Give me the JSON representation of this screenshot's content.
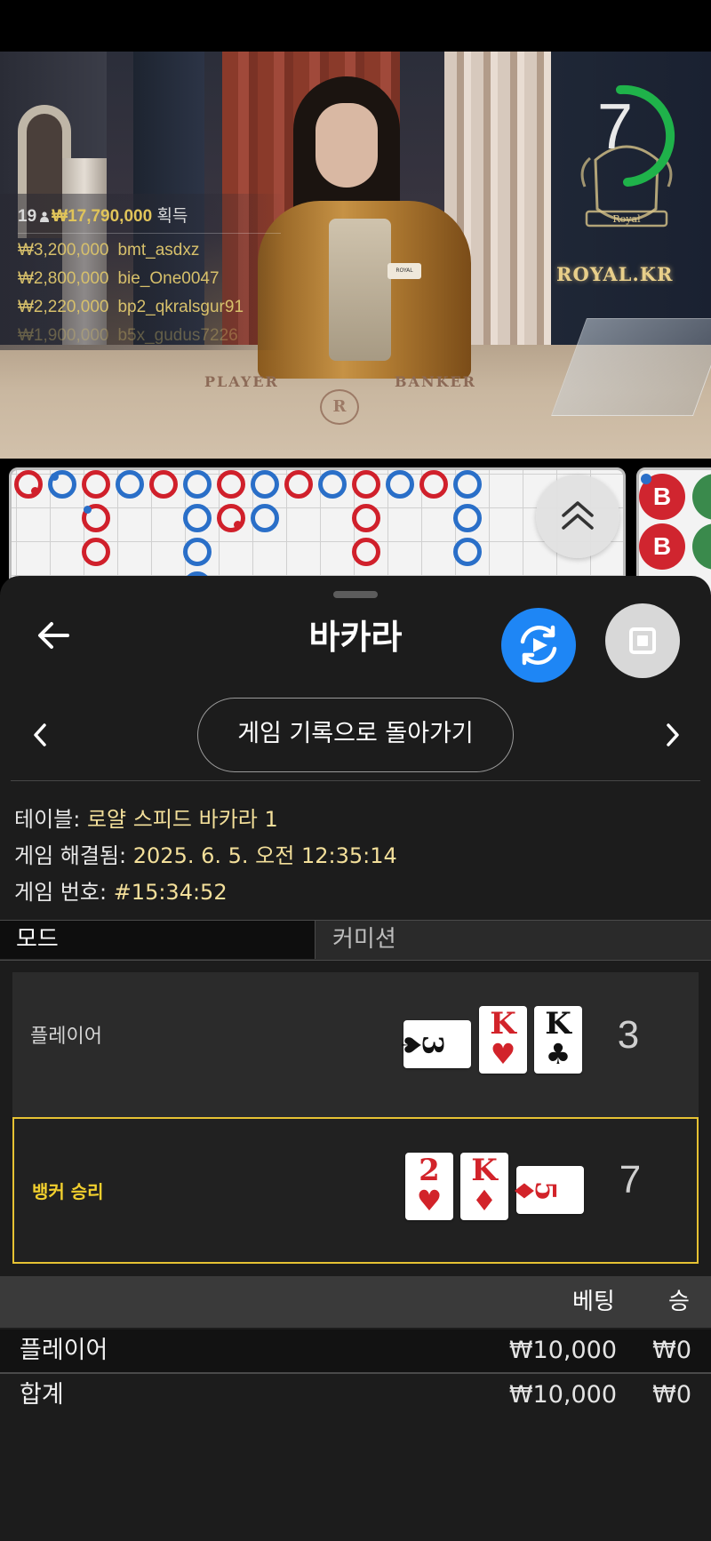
{
  "video": {
    "timer": "7",
    "brand": "ROYAL.KR",
    "crest_text": "Royal",
    "dealer_badge": "ROYAL",
    "table_player": "PLAYER",
    "table_banker": "BANKER",
    "table_logo": "R"
  },
  "winners": {
    "count": "19",
    "total": "₩17,790,000",
    "total_label": "획득",
    "rows": [
      {
        "amount": "₩3,200,000",
        "name": "bmt_asdxz"
      },
      {
        "amount": "₩2,800,000",
        "name": "bie_One0047"
      },
      {
        "amount": "₩2,220,000",
        "name": "bp2_qkralsgur91"
      },
      {
        "amount": "₩1,900,000",
        "name": "b5x_gudus7226"
      }
    ]
  },
  "scoreboard": {
    "bead_label": "B"
  },
  "sheet": {
    "title": "바카라",
    "back_to_history": "게임 기록으로 돌아가기",
    "info": {
      "table_label": "테이블:",
      "table_value": "로얄 스피드 바카라 1",
      "resolved_label": "게임 해결됨:",
      "resolved_value": "2025. 6. 5. 오전 12:35:14",
      "number_label": "게임 번호:",
      "number_value": "#15:34:52"
    },
    "tabs": [
      "모드",
      "커미션"
    ],
    "hands": {
      "player": {
        "label": "플레이어",
        "score": "3",
        "cards": [
          {
            "rank": "3",
            "suit": "♠",
            "color": "black",
            "sideways": true
          },
          {
            "rank": "K",
            "suit": "♥",
            "color": "red"
          },
          {
            "rank": "K",
            "suit": "♣",
            "color": "black"
          }
        ]
      },
      "banker": {
        "label": "뱅커 승리",
        "score": "7",
        "cards": [
          {
            "rank": "2",
            "suit": "♥",
            "color": "red"
          },
          {
            "rank": "K",
            "suit": "♦",
            "color": "red"
          },
          {
            "rank": "5",
            "suit": "♦",
            "color": "red",
            "sideways": true
          }
        ]
      }
    },
    "bets": {
      "headers": {
        "bet": "베팅",
        "win": "승"
      },
      "rows": [
        {
          "label": "플레이어",
          "bet": "₩10,000",
          "win": "₩0"
        }
      ],
      "total": {
        "label": "합계",
        "bet": "₩10,000",
        "win": "₩0"
      }
    }
  },
  "colors": {
    "accent_blue": "#1e86f5",
    "win_gold": "#e6c233",
    "timer_green": "#1fb24a",
    "player_blue": "#2a6fc8",
    "banker_red": "#d0202b"
  }
}
